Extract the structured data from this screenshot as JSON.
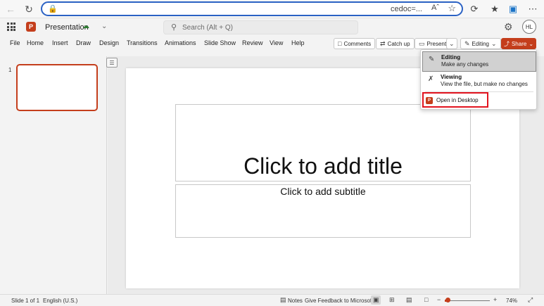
{
  "browser": {
    "url_text": "cedoc=...",
    "reader_label": "Aˆ"
  },
  "app": {
    "logo_letter": "P",
    "file_name": "Presentation",
    "search_placeholder": "Search (Alt + Q)",
    "avatar_initials": "HL"
  },
  "ribbon": {
    "tabs": [
      "File",
      "Home",
      "Insert",
      "Draw",
      "Design",
      "Transitions",
      "Animations",
      "Slide Show",
      "Review",
      "View",
      "Help"
    ],
    "comments_label": "Comments",
    "catchup_label": "Catch up",
    "present_label": "Present",
    "editing_label": "Editing",
    "share_label": "Share"
  },
  "thumbnails": {
    "slide_number": "1"
  },
  "slide": {
    "title_placeholder": "Click to add title",
    "subtitle_placeholder": "Click to add subtitle"
  },
  "editing_menu": {
    "editing_title": "Editing",
    "editing_desc": "Make any changes",
    "viewing_title": "Viewing",
    "viewing_desc": "View the file, but make no changes",
    "open_desktop": "Open in Desktop"
  },
  "statusbar": {
    "slide_count": "Slide 1 of 1",
    "language": "English (U.S.)",
    "notes_label": "Notes",
    "feedback_label": "Give Feedback to Microsoft",
    "zoom_level": "74%",
    "zoom_fraction": 0.06
  },
  "colors": {
    "accent": "#c43e1c",
    "highlight_border": "#e2141f",
    "url_border": "#2b62c4"
  }
}
